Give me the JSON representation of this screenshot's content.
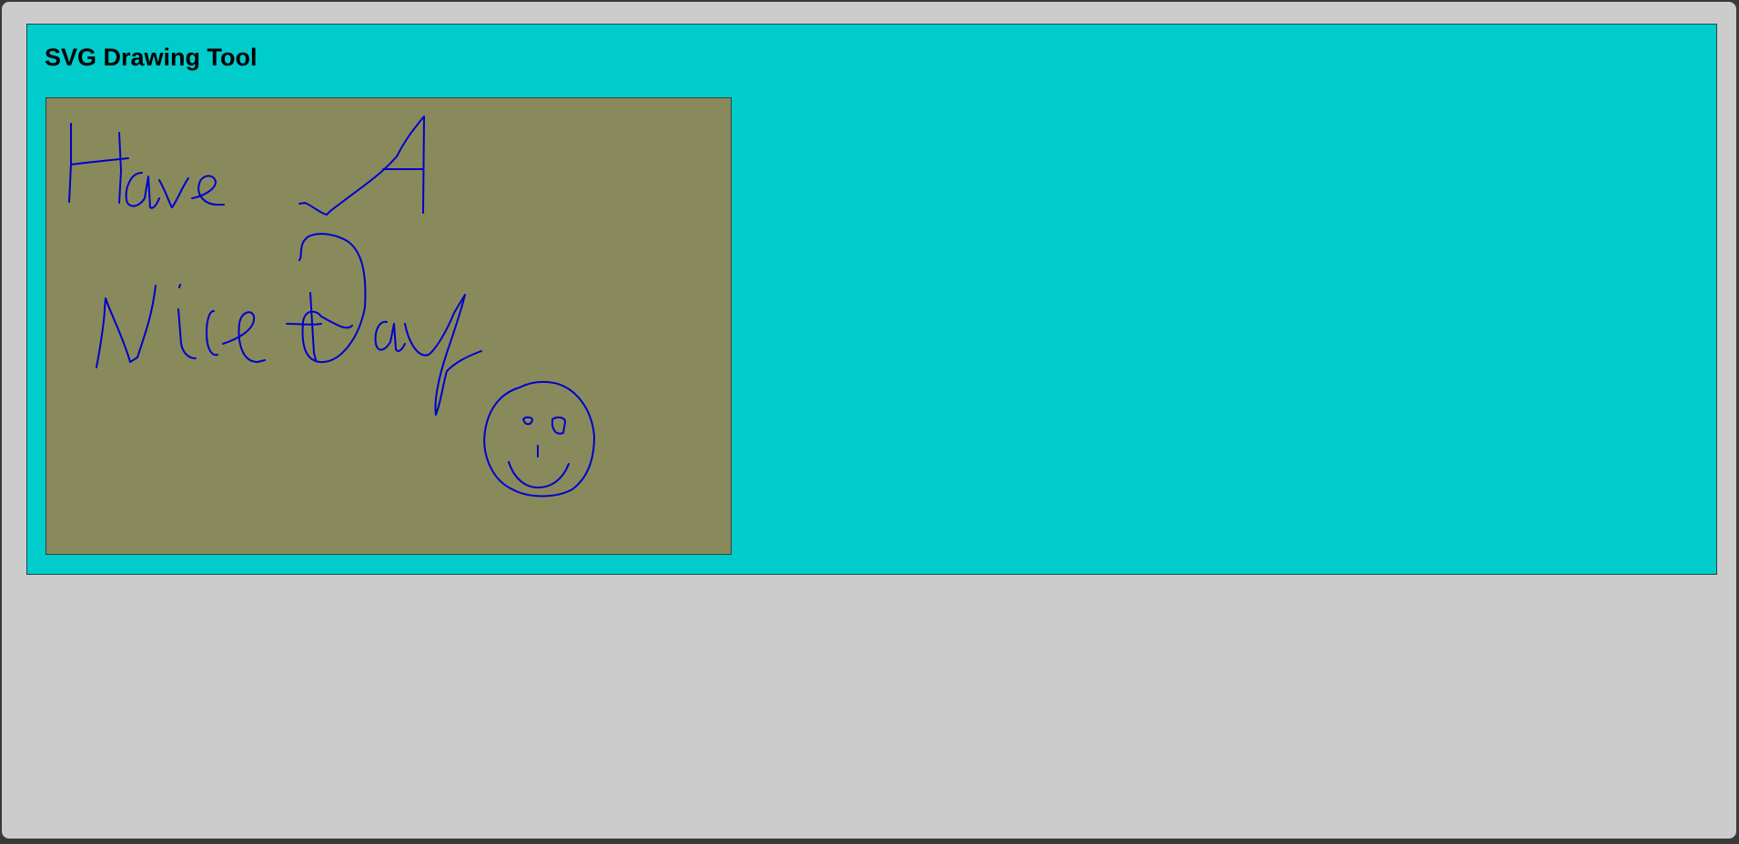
{
  "app": {
    "title": "SVG Drawing Tool"
  },
  "colors": {
    "page_background": "#cccccc",
    "panel_background": "#00cccc",
    "canvas_background": "#888a5c",
    "stroke": "#0000cc"
  },
  "canvas": {
    "content": "Have A Nice Day"
  }
}
